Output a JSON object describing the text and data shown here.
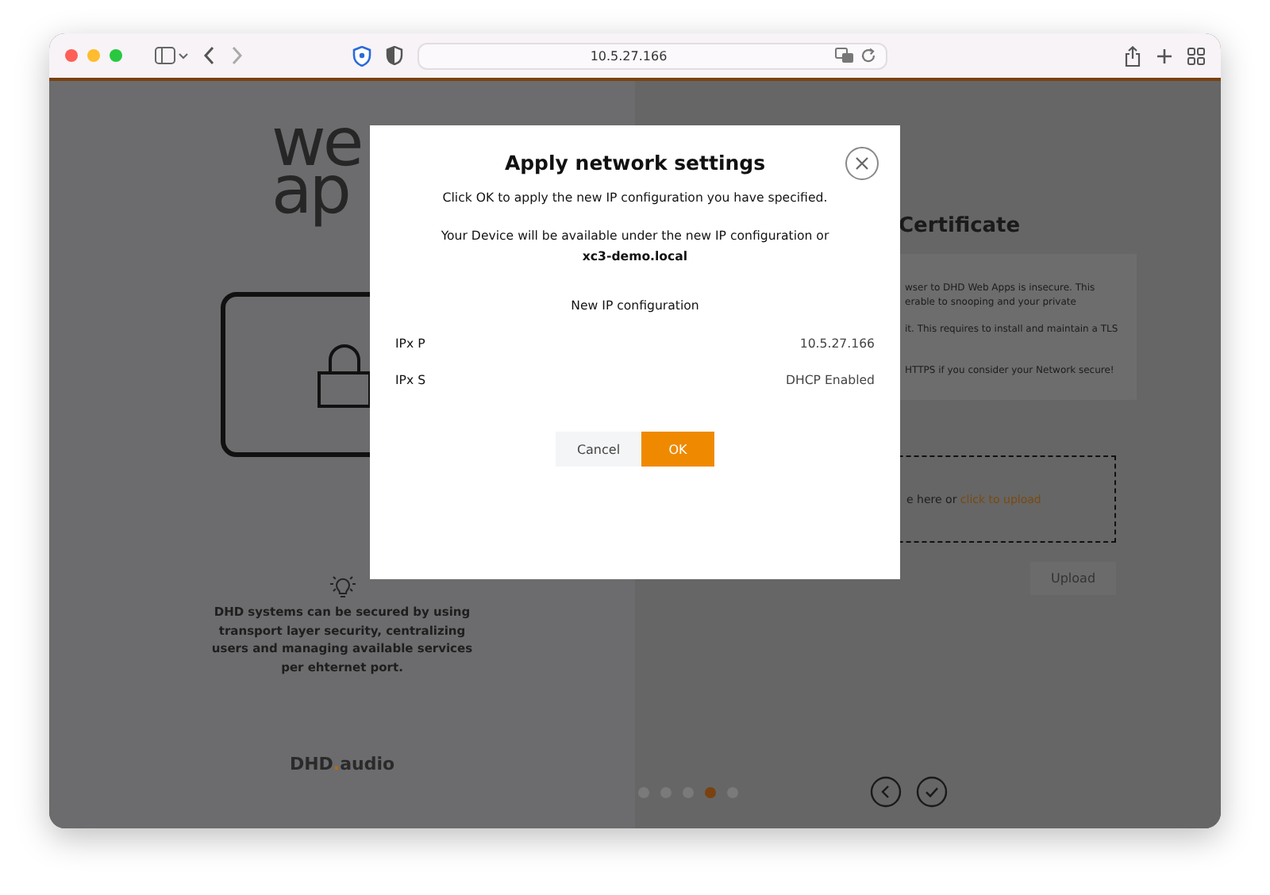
{
  "browser": {
    "url": "10.5.27.166"
  },
  "left_panel": {
    "logo_lines": [
      "we",
      "ap"
    ],
    "tip": "DHD systems can be secured by using transport layer security, centralizing users and managing available services per ehternet port.",
    "brand_parts": [
      "DHD",
      ".",
      "audio"
    ]
  },
  "right_panel": {
    "heading": "Certificate",
    "info_lines": [
      "wser to DHD Web Apps is insecure. This",
      "erable to snooping and your private",
      "it. This requires to install and maintain a TLS",
      "HTTPS if you consider your Network secure!"
    ],
    "dropzone": {
      "text": "e here or ",
      "link": "click to upload"
    },
    "upload_button": "Upload"
  },
  "steps": [
    {
      "selected": false
    },
    {
      "selected": false
    },
    {
      "selected": false
    },
    {
      "selected": true
    },
    {
      "selected": false
    }
  ],
  "dialog": {
    "title": "Apply network settings",
    "message": "Click OK to apply the new IP configuration you have specified.",
    "availability": "Your Device will be available under the new IP configuration or",
    "hostname": "xc3-demo.local",
    "section": "New IP configuration",
    "rows": [
      {
        "label": "IPx P",
        "value": "10.5.27.166"
      },
      {
        "label": "IPx S",
        "value": "DHCP Enabled"
      }
    ],
    "buttons": [
      {
        "label": "Cancel",
        "kind": "secondary"
      },
      {
        "label": "OK",
        "kind": "primary"
      }
    ]
  }
}
